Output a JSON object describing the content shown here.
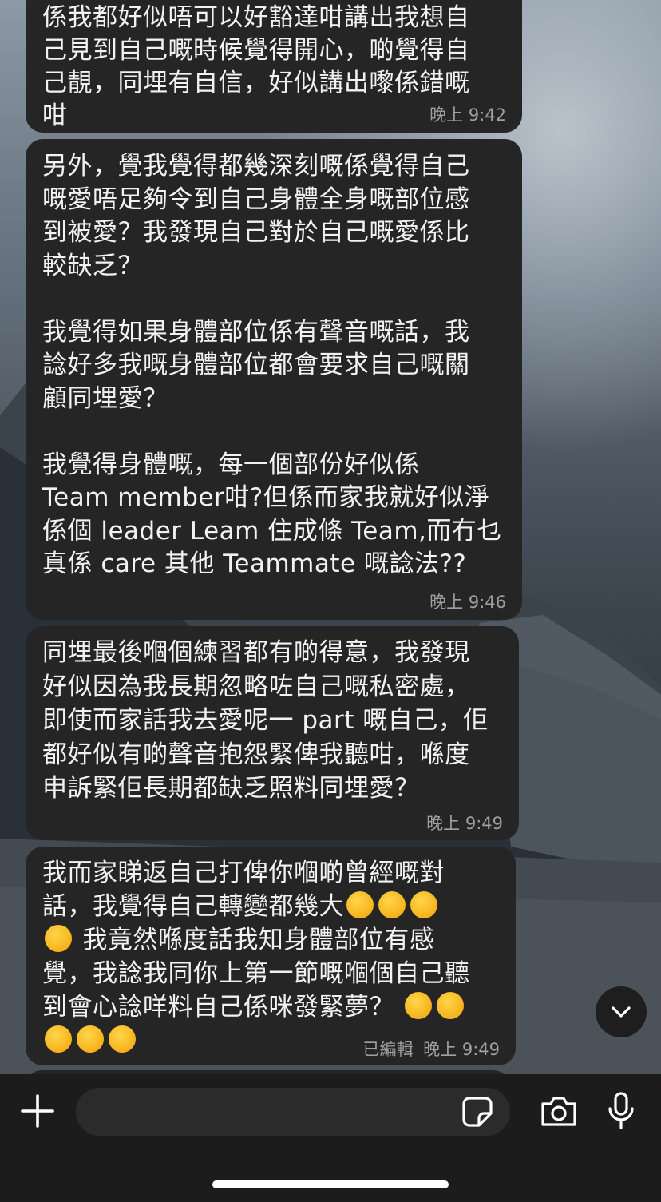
{
  "messages": [
    {
      "text": "係我都好似唔可以好豁達咁講出我想自\n己見到自己嘅時候覺得開心，啲覺得自\n己靚，同埋有自信，好似講出嚟係錯嘅\n咁",
      "time": "晚上 9:42"
    },
    {
      "text": "另外，覺我覺得都幾深刻嘅係覺得自己\n嘅愛唔足夠令到自己身體全身嘅部位感\n到被愛？我發現自己對於自己嘅愛係比\n較缺乏？\n\n我覺得如果身體部位係有聲音嘅話，我\n諗好多我嘅身體部位都會要求自己嘅關\n顧同埋愛？\n\n我覺得身體嘅，每一個部份好似係\nTeam member咁?但係而家我就好似淨\n係個 leader Leam 住成條 Team,而冇乜\n真係 care 其他 Teammate 嘅諗法??",
      "time": "晚上 9:46"
    },
    {
      "text": "同埋最後嗰個練習都有啲得意，我發現\n好似因為我長期忽略咗自己嘅私密處，\n即使而家話我去愛呢一 part 嘅自己，佢\n都好似有啲聲音抱怨緊俾我聽咁，喺度\n申訴緊佢長期都缺乏照料同埋愛？",
      "time": "晚上 9:49"
    },
    {
      "text_line1": "我而家睇返自己打俾你嗰啲曾經嘅對",
      "text_line2": "話，我覺得自己轉變都幾大",
      "text_line3": " 我竟然喺度話我知身體部位有感",
      "text_line4": "覺，我諗我同你上第一節嘅嗰個自己聽",
      "text_line5": "到會心諗咩料自己係咪發緊夢？ ",
      "edited": "已編輯",
      "time": "晚上 9:49"
    }
  ],
  "composer": {
    "placeholder": ""
  },
  "icons": {
    "plus": "plus-icon",
    "sticker": "sticker-icon",
    "camera": "camera-icon",
    "mic": "microphone-icon",
    "scroll_down": "chevron-down-icon",
    "emoji": "rolling-on-floor-laughing-emoji"
  },
  "colors": {
    "bubble": "#252525",
    "text": "#f2f2f2",
    "timestamp": "#a0a0a0",
    "bar": "#1c1c1c"
  }
}
